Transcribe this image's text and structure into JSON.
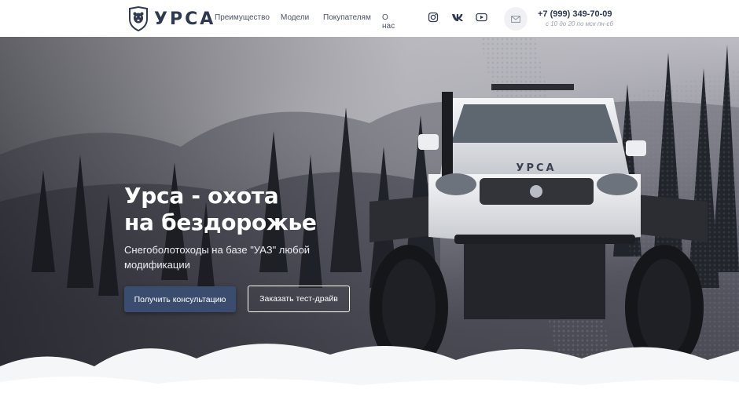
{
  "brand": {
    "name": "УРСА",
    "logo_icon": "bear-shield-icon"
  },
  "nav": {
    "items": [
      {
        "label": "Преимущество"
      },
      {
        "label": "Модели"
      },
      {
        "label": "Покупателям"
      },
      {
        "label": "О нас"
      }
    ]
  },
  "social": [
    {
      "icon": "instagram-icon"
    },
    {
      "icon": "vk-icon"
    },
    {
      "icon": "youtube-icon"
    }
  ],
  "contact": {
    "mail_icon": "mail-icon",
    "phone": "+7 (999) 349-70-09",
    "hours": "с 10 до 20 по мск пн-сб"
  },
  "hero": {
    "title_line1": "Урса - охота",
    "title_line2": "на бездорожье",
    "subtitle": "Снегоболотоходы на базе \"УАЗ\" любой модификации",
    "cta_primary": "Получить консультацию",
    "cta_secondary": "Заказать тест-драйв",
    "vehicle_badge": "УРСА"
  },
  "colors": {
    "brand_dark": "#2f3a50",
    "button_primary": "#3a4d6e",
    "header_bg": "#ffffff"
  }
}
